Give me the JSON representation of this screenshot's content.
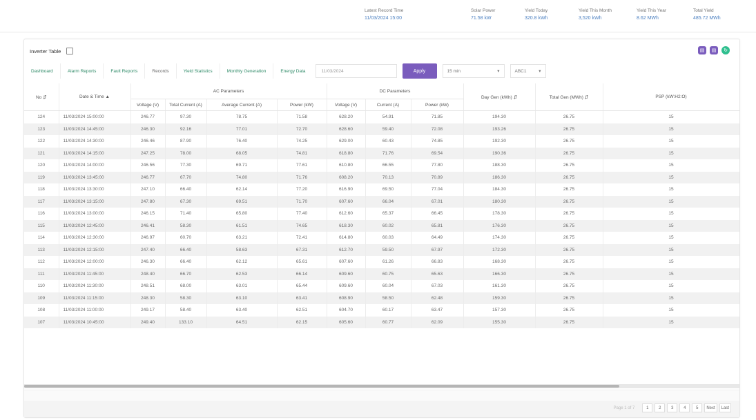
{
  "stats": [
    {
      "label": "Latest Record Time",
      "value": "11/03/2024 15:00"
    },
    {
      "label": "Solar Power",
      "value": "71.58 kW"
    },
    {
      "label": "Yield Today",
      "value": "320.8 kWh"
    },
    {
      "label": "Yield This Month",
      "value": "3,520 kWh"
    },
    {
      "label": "Yield This Year",
      "value": "8.62 MWh"
    },
    {
      "label": "Total Yield",
      "value": "485.72 MWh"
    }
  ],
  "card": {
    "title": "Inverter Table",
    "tabs": [
      "Dashboard",
      "Alarm Reports",
      "Fault Reports",
      "Records",
      "Yield Statistics",
      "Monthly Generation",
      "Energy Data"
    ],
    "date_value": "11/03/2024",
    "apply_label": "Apply",
    "select_1": "15 min",
    "select_2": "ABC1"
  },
  "table": {
    "group_headers": [
      "AC Parameters",
      "DC Parameters"
    ],
    "headers": [
      "No",
      "Date & Time",
      "Voltage (V)",
      "Total Current (A)",
      "Average Current (A)",
      "Power (kW)",
      "Voltage (V)",
      "Current (A)",
      "Power (kW)",
      "Day Gen (kWh)",
      "Total Gen (MWh)",
      "PSP (kW:H2:O)"
    ],
    "rows": [
      [
        "124",
        "11/03/2024 15:00:00",
        "246.77",
        "97.30",
        "78.75",
        "71.58",
        "628.20",
        "54.91",
        "71.85",
        "194.30",
        "26.75",
        "15"
      ],
      [
        "123",
        "11/03/2024 14:45:00",
        "246.30",
        "92.16",
        "77.01",
        "72.70",
        "628.60",
        "59.40",
        "72.08",
        "193.26",
        "26.75",
        "15"
      ],
      [
        "122",
        "11/03/2024 14:30:00",
        "246.46",
        "87.90",
        "76.40",
        "74.25",
        "629.00",
        "60.43",
        "74.85",
        "192.30",
        "26.75",
        "15"
      ],
      [
        "121",
        "11/03/2024 14:15:00",
        "247.25",
        "78.00",
        "68.05",
        "74.81",
        "618.80",
        "71.76",
        "69.54",
        "190.36",
        "26.75",
        "15"
      ],
      [
        "120",
        "11/03/2024 14:00:00",
        "246.56",
        "77.30",
        "69.71",
        "77.61",
        "610.80",
        "66.55",
        "77.80",
        "188.30",
        "26.75",
        "15"
      ],
      [
        "119",
        "11/03/2024 13:45:00",
        "246.77",
        "67.70",
        "74.80",
        "71.76",
        "608.20",
        "70.13",
        "70.89",
        "186.30",
        "26.75",
        "15"
      ],
      [
        "118",
        "11/03/2024 13:30:00",
        "247.10",
        "66.40",
        "62.14",
        "77.20",
        "616.90",
        "69.50",
        "77.04",
        "184.30",
        "26.75",
        "15"
      ],
      [
        "117",
        "11/03/2024 13:15:00",
        "247.80",
        "67.30",
        "69.51",
        "71.70",
        "607.60",
        "66.04",
        "67.01",
        "180.30",
        "26.75",
        "15"
      ],
      [
        "116",
        "11/03/2024 13:00:00",
        "246.15",
        "71.40",
        "65.80",
        "77.40",
        "612.60",
        "65.37",
        "66.45",
        "178.30",
        "26.75",
        "15"
      ],
      [
        "115",
        "11/03/2024 12:45:00",
        "246.41",
        "58.30",
        "61.51",
        "74.65",
        "618.30",
        "60.02",
        "65.81",
        "176.30",
        "26.75",
        "15"
      ],
      [
        "114",
        "11/03/2024 12:30:00",
        "246.97",
        "60.70",
        "63.21",
        "72.41",
        "614.80",
        "60.03",
        "64.49",
        "174.30",
        "26.75",
        "15"
      ],
      [
        "113",
        "11/03/2024 12:15:00",
        "247.40",
        "66.40",
        "58.63",
        "67.31",
        "612.70",
        "59.50",
        "67.97",
        "172.30",
        "26.75",
        "15"
      ],
      [
        "112",
        "11/03/2024 12:00:00",
        "246.30",
        "66.40",
        "62.12",
        "65.61",
        "607.60",
        "61.26",
        "66.83",
        "168.30",
        "26.75",
        "15"
      ],
      [
        "111",
        "11/03/2024 11:45:00",
        "248.40",
        "66.70",
        "62.53",
        "66.14",
        "609.60",
        "60.75",
        "65.63",
        "166.30",
        "26.75",
        "15"
      ],
      [
        "110",
        "11/03/2024 11:30:00",
        "248.51",
        "68.00",
        "63.01",
        "65.44",
        "609.60",
        "60.04",
        "67.03",
        "161.30",
        "26.75",
        "15"
      ],
      [
        "109",
        "11/03/2024 11:15:00",
        "248.30",
        "58.30",
        "63.10",
        "63.41",
        "608.90",
        "58.50",
        "62.48",
        "159.30",
        "26.75",
        "15"
      ],
      [
        "108",
        "11/03/2024 11:00:00",
        "249.17",
        "58.40",
        "63.40",
        "62.51",
        "604.70",
        "60.17",
        "63.47",
        "157.30",
        "26.75",
        "15"
      ],
      [
        "107",
        "11/03/2024 10:45:00",
        "249.40",
        "133.10",
        "64.51",
        "62.15",
        "605.60",
        "60.77",
        "62.09",
        "155.30",
        "26.75",
        "15"
      ]
    ]
  },
  "pager": {
    "info": "Page 1 of 7",
    "buttons": [
      "1",
      "2",
      "3",
      "4",
      "5",
      "Next",
      "Last"
    ]
  }
}
